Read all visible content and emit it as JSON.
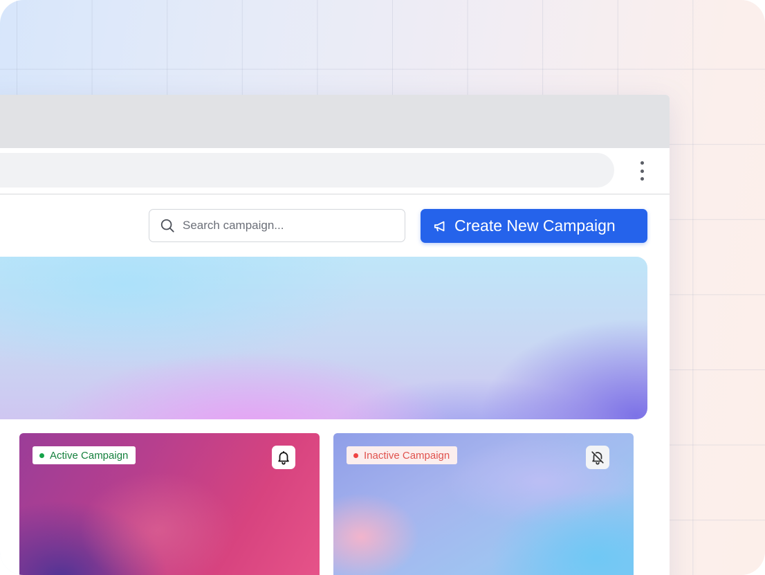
{
  "toolbar": {
    "menu_icon": "kebab-menu-icon"
  },
  "search": {
    "placeholder": "Search campaign...",
    "icon": "search-icon"
  },
  "create_button": {
    "label": "Create New Campaign",
    "icon": "megaphone-icon",
    "color": "#2563eb"
  },
  "campaigns": [
    {
      "status": "Active Campaign",
      "status_color": "#16a34a",
      "notification_icon": "bell-icon"
    },
    {
      "status": "Inactive Campaign",
      "status_color": "#ef4444",
      "notification_icon": "bell-off-icon"
    }
  ]
}
